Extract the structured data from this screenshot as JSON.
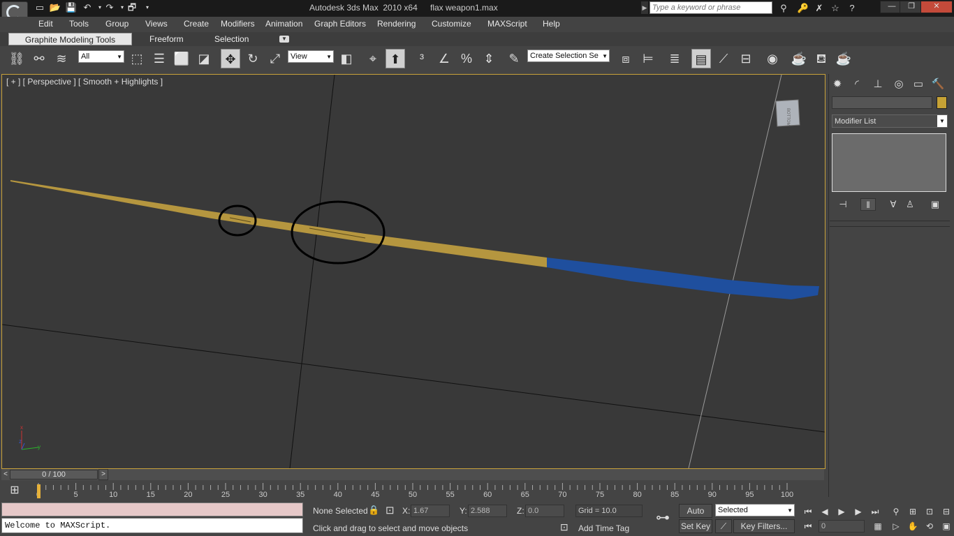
{
  "titlebar": {
    "app_title": "Autodesk 3ds Max  2010 x64",
    "file_name": "flax weapon1.max",
    "search_placeholder": "Type a keyword or phrase",
    "minimize": "—",
    "maximize": "❐",
    "close": "✕"
  },
  "menu": [
    "Edit",
    "Tools",
    "Group",
    "Views",
    "Create",
    "Modifiers",
    "Animation",
    "Graph Editors",
    "Rendering",
    "Customize",
    "MAXScript",
    "Help"
  ],
  "ribbon": {
    "tab_graphite": "Graphite Modeling Tools",
    "tab_freeform": "Freeform",
    "tab_selection": "Selection"
  },
  "toolbar": {
    "selection_filter": "All",
    "reference_coord": "View",
    "named_selection": "Create Selection Se"
  },
  "viewport": {
    "label": "[ + ] [ Perspective ] [ Smooth + Highlights ]",
    "viewcube_label": "BOTTOM",
    "axis_x": "x",
    "axis_y": "y",
    "axis_z": "z",
    "colors": {
      "blade": "#b5963f",
      "handle": "#1f4f9e",
      "selected_border": "#c9a23a"
    }
  },
  "command_panel": {
    "modifier_list": "Modifier List",
    "object_color": "#c6a235"
  },
  "timeline": {
    "slider_text": "0 / 100",
    "current_frame": 0,
    "total_frames": 100,
    "ticks": [
      "0",
      "5",
      "10",
      "15",
      "20",
      "25",
      "30",
      "35",
      "40",
      "45",
      "50",
      "55",
      "60",
      "65",
      "70",
      "75",
      "80",
      "85",
      "90",
      "95",
      "100"
    ]
  },
  "status": {
    "selection": "None Selected",
    "x_label": "X:",
    "x_value": "1.67",
    "y_label": "Y:",
    "y_value": "2.588",
    "z_label": "Z:",
    "z_value": "0.0",
    "grid": "Grid = 10.0",
    "prompt": "Click and drag to select and move objects",
    "add_time_tag": "Add Time Tag",
    "maxscript_output": "Welcome to MAXScript."
  },
  "anim": {
    "auto_key": "Auto Key",
    "set_key": "Set Key",
    "key_mode": "Selected",
    "key_filters": "Key Filters...",
    "frame_field": "0"
  }
}
